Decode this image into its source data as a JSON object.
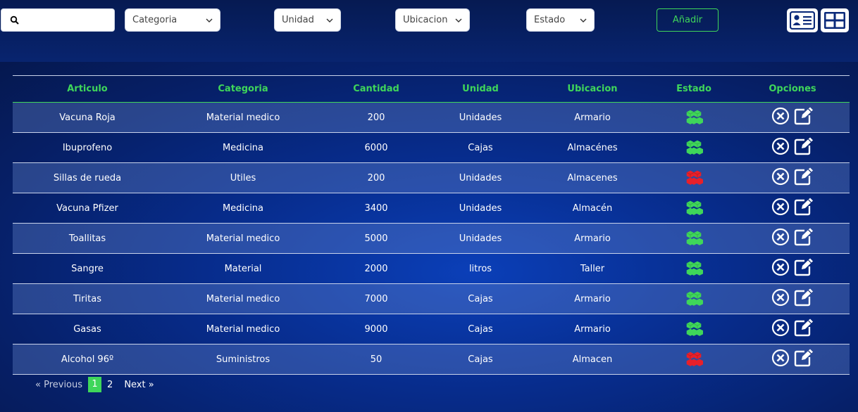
{
  "toolbar": {
    "search": {
      "value": "",
      "placeholder": ""
    },
    "filters": [
      {
        "label": "Categoria"
      },
      {
        "label": "Unidad"
      },
      {
        "label": "Ubicacion"
      },
      {
        "label": "Estado"
      }
    ],
    "add_label": "Añadir",
    "view_icons": [
      "id-card-icon",
      "grid-view-icon"
    ]
  },
  "table": {
    "headers": [
      "Articulo",
      "Categoria",
      "Cantidad",
      "Unidad",
      "Ubicacion",
      "Estado",
      "Opciones"
    ],
    "rows": [
      {
        "articulo": "Vacuna Roja",
        "categoria": "Material medico",
        "cantidad": "200",
        "unidad": "Unidades",
        "ubicacion": "Armario",
        "estado": "ok"
      },
      {
        "articulo": "Ibuprofeno",
        "categoria": "Medicina",
        "cantidad": "6000",
        "unidad": "Cajas",
        "ubicacion": "Almacénes",
        "estado": "ok"
      },
      {
        "articulo": "Sillas de rueda",
        "categoria": "Utiles",
        "cantidad": "200",
        "unidad": "Unidades",
        "ubicacion": "Almacenes",
        "estado": "low"
      },
      {
        "articulo": "Vacuna Pfizer",
        "categoria": "Medicina",
        "cantidad": "3400",
        "unidad": "Unidades",
        "ubicacion": "Almacén",
        "estado": "ok"
      },
      {
        "articulo": "Toallitas",
        "categoria": "Material medico",
        "cantidad": "5000",
        "unidad": "Unidades",
        "ubicacion": "Armario",
        "estado": "ok"
      },
      {
        "articulo": "Sangre",
        "categoria": "Material",
        "cantidad": "2000",
        "unidad": "litros",
        "ubicacion": "Taller",
        "estado": "ok"
      },
      {
        "articulo": "Tiritas",
        "categoria": "Material medico",
        "cantidad": "7000",
        "unidad": "Cajas",
        "ubicacion": "Armario",
        "estado": "ok"
      },
      {
        "articulo": "Gasas",
        "categoria": "Material medico",
        "cantidad": "9000",
        "unidad": "Cajas",
        "ubicacion": "Armario",
        "estado": "ok"
      },
      {
        "articulo": "Alcohol 96º",
        "categoria": "Suministros",
        "cantidad": "50",
        "unidad": "Cajas",
        "ubicacion": "Almacen",
        "estado": "low"
      }
    ]
  },
  "pagination": {
    "prev": "« Previous",
    "pages": [
      "1",
      "2"
    ],
    "current": "1",
    "next": "Next »"
  },
  "colors": {
    "accent": "#3fd65a",
    "status_ok": "#3fd65a",
    "status_low": "#e8202a"
  }
}
